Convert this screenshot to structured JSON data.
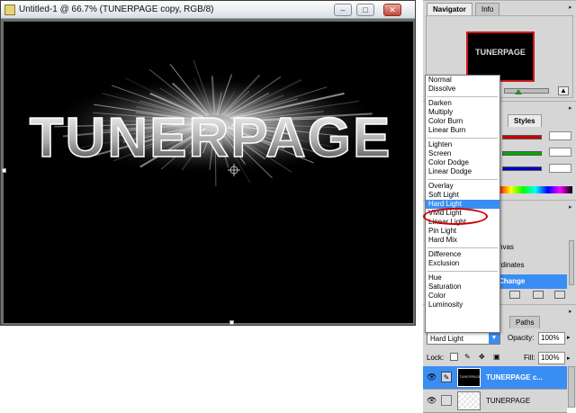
{
  "document": {
    "title": "Untitled-1 @ 66.7% (TUNERPAGE copy, RGB/8)",
    "canvas_text": "TUNERPAGE",
    "buttons": {
      "minimize": "‒",
      "maximize": "□",
      "close": "✕"
    }
  },
  "navigator": {
    "tabs": [
      "Navigator",
      "Info"
    ],
    "thumbnail_text": "TUNERPAGE"
  },
  "color_panel": {
    "tab": "Styles",
    "colors": {
      "red": "#e00000",
      "green": "#00b000",
      "blue": "#0000d0"
    }
  },
  "history_panel": {
    "items": [
      "nvas",
      "rdinates",
      "Change"
    ]
  },
  "blend_modes": {
    "groups": [
      [
        "Normal",
        "Dissolve"
      ],
      [
        "Darken",
        "Multiply",
        "Color Burn",
        "Linear Burn"
      ],
      [
        "Lighten",
        "Screen",
        "Color Dodge",
        "Linear Dodge"
      ],
      [
        "Overlay",
        "Soft Light",
        "Hard Light",
        "Vivid Light",
        "Linear Light",
        "Pin Light",
        "Hard Mix"
      ],
      [
        "Difference",
        "Exclusion"
      ],
      [
        "Hue",
        "Saturation",
        "Color",
        "Luminosity"
      ]
    ],
    "selected": "Hard Light"
  },
  "layers": {
    "tab": "Paths",
    "blend_value": "Hard Light",
    "opacity_label": "Opacity:",
    "opacity_value": "100%",
    "lock_label": "Lock:",
    "fill_label": "Fill:",
    "fill_value": "100%",
    "rows": [
      {
        "name": "TUNERPAGE c...",
        "thumb": "TUNERPAGE",
        "selected": true
      },
      {
        "name": "TUNERPAGE",
        "selected": false
      }
    ]
  },
  "accent_color": "#3a8ef3",
  "highlight_circle_color": "#cc0000"
}
